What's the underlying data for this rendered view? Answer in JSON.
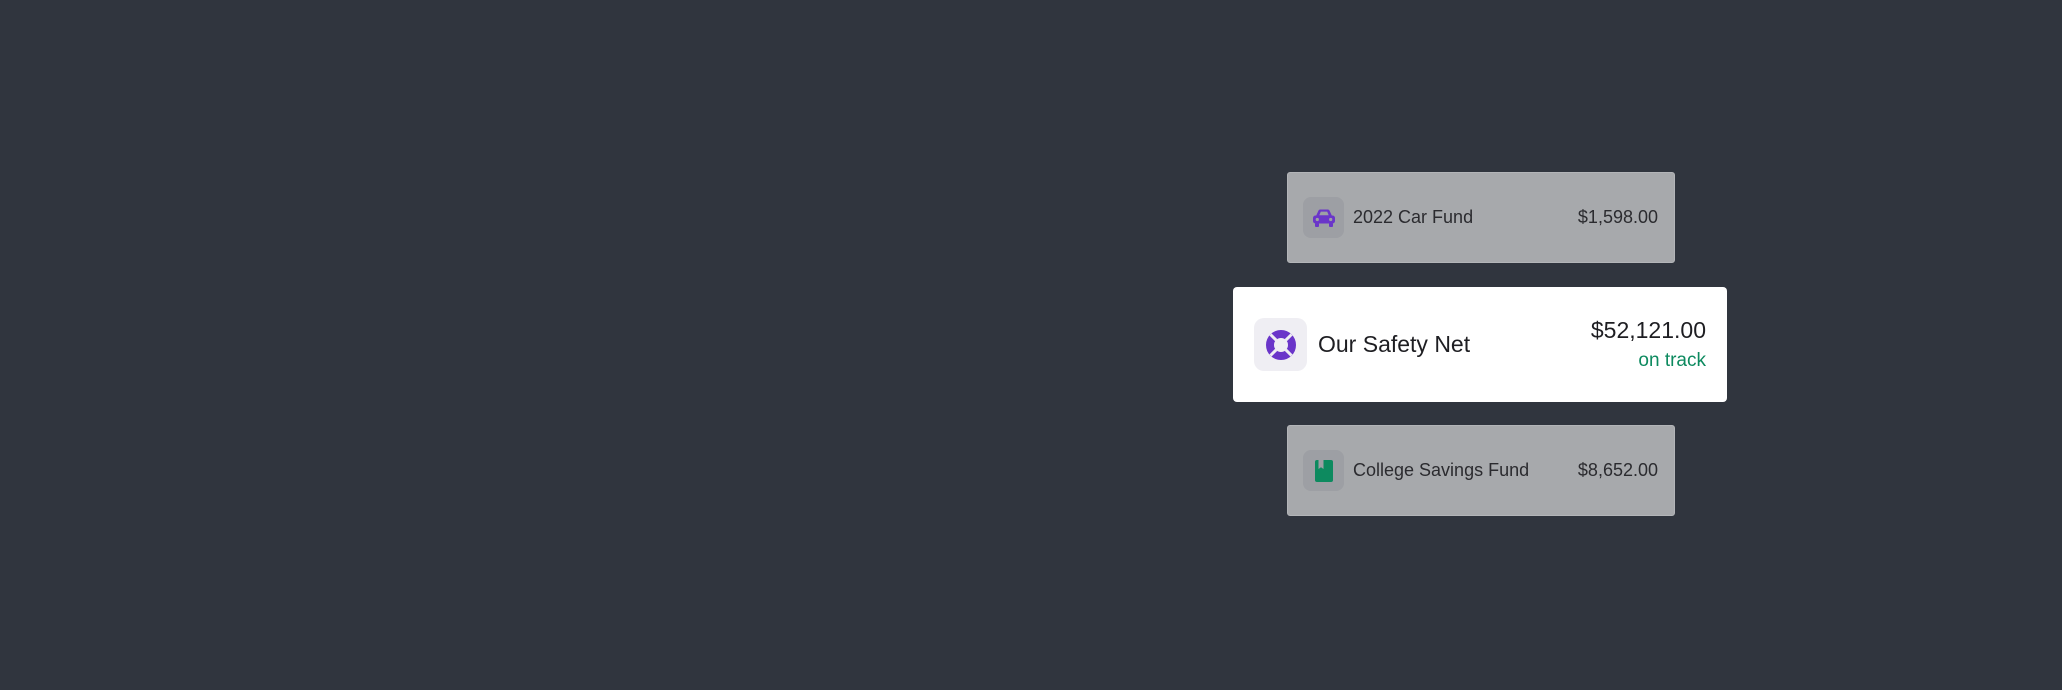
{
  "goals": [
    {
      "name": "2022 Car Fund",
      "amount": "$1,598.00",
      "icon": "car-icon"
    },
    {
      "name": "Our Safety Net",
      "amount": "$52,121.00",
      "status": "on track",
      "icon": "life-ring-icon"
    },
    {
      "name": "College Savings Fund",
      "amount": "$8,652.00",
      "icon": "book-icon"
    }
  ],
  "colors": {
    "background": "#30353e",
    "accent_purple": "#6a35c9",
    "accent_green": "#0d8a5f",
    "status_green": "#0d8a5f"
  }
}
